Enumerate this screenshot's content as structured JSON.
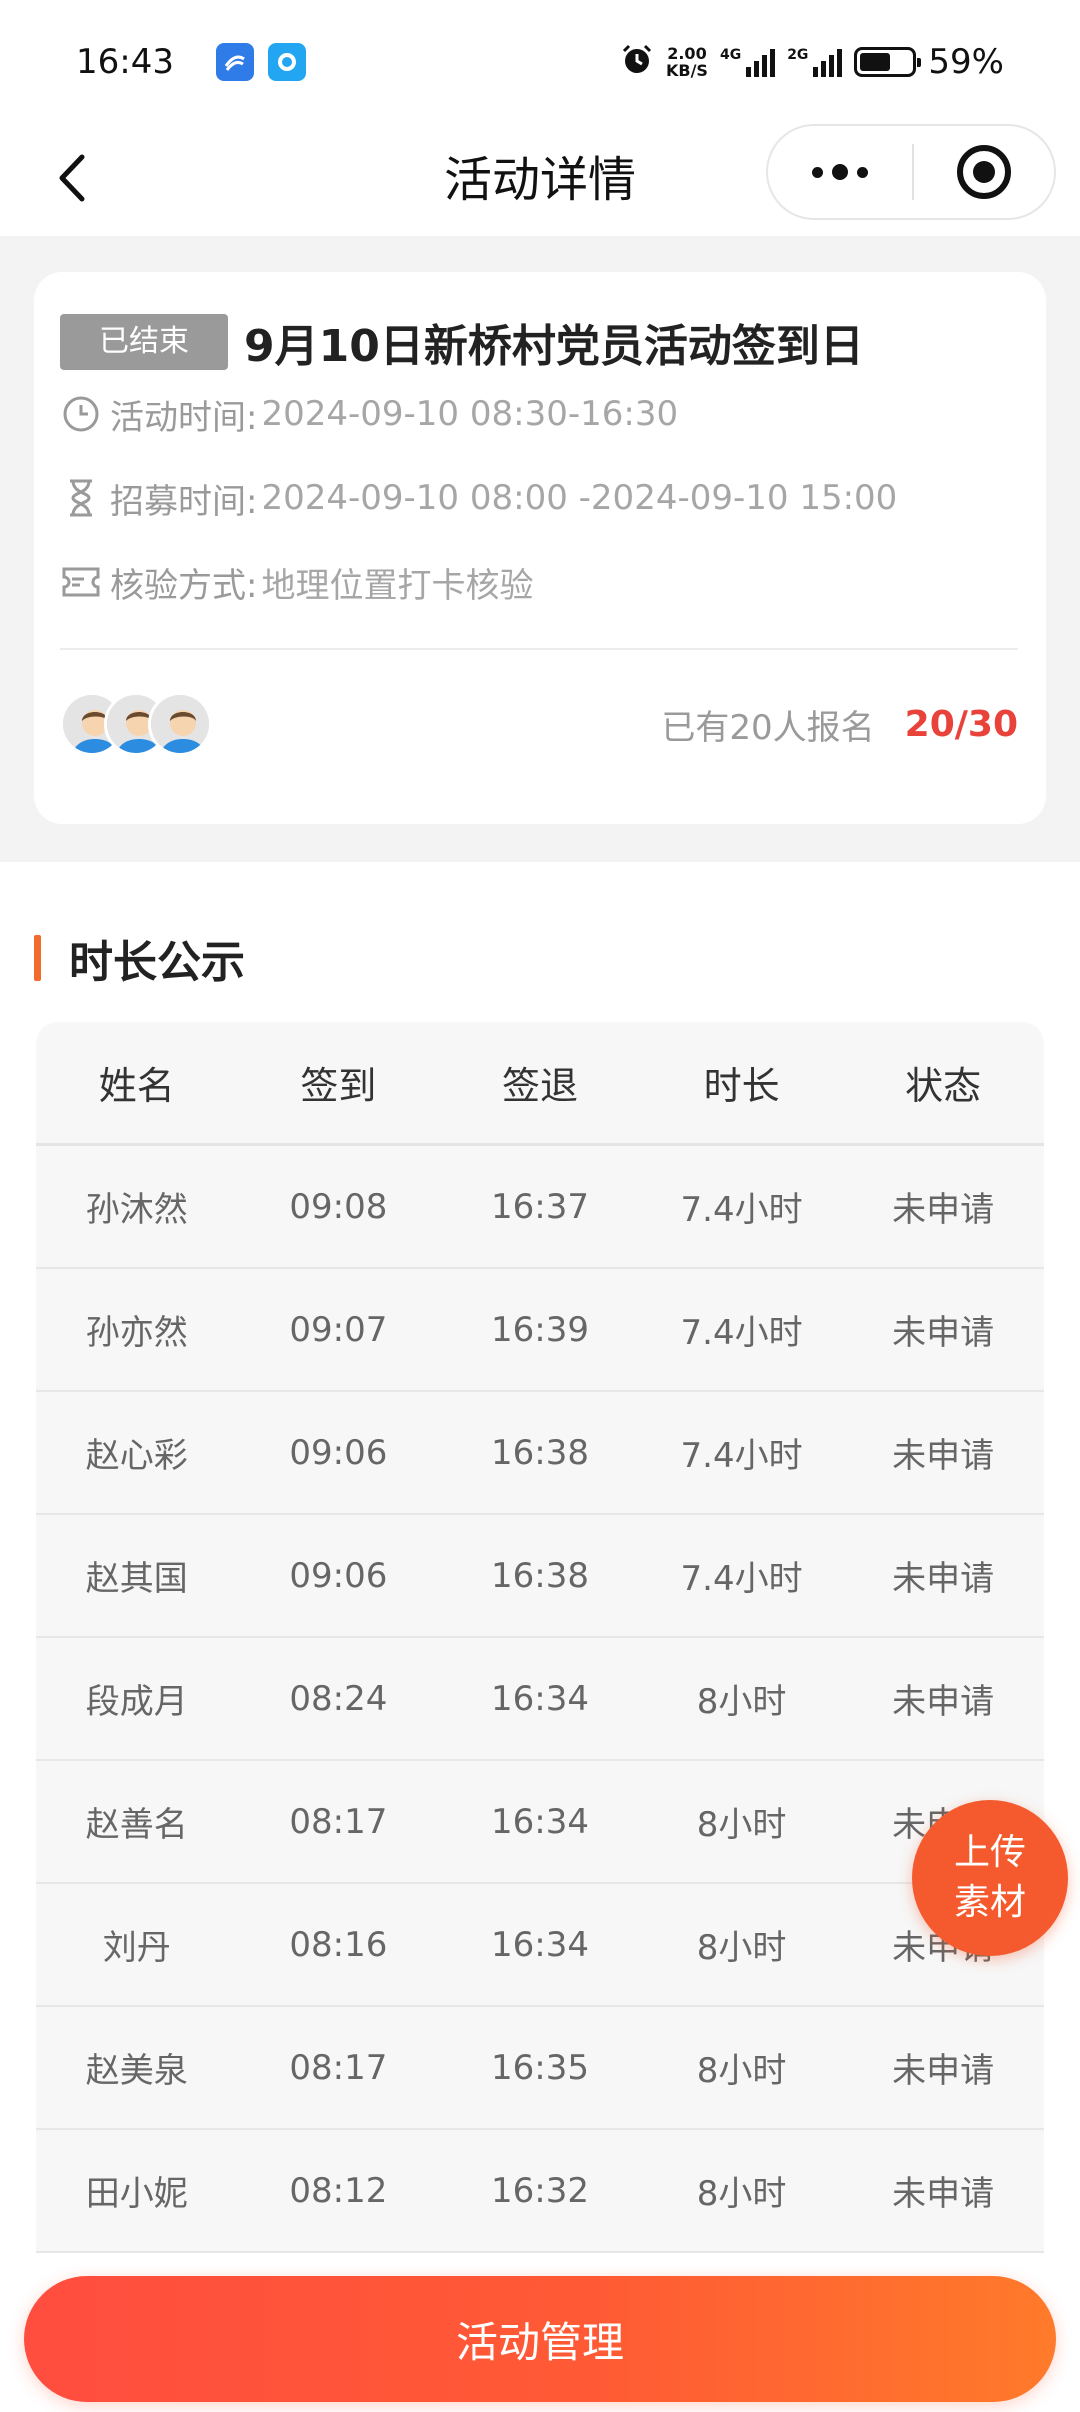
{
  "status_bar": {
    "time": "16:43",
    "net_speed_value": "2.00",
    "net_speed_unit": "KB/S",
    "net1_label": "4G",
    "net2_label": "2G",
    "battery_percent": "59%",
    "battery_level": 0.59
  },
  "nav": {
    "title": "活动详情"
  },
  "activity": {
    "status_tag": "已结束",
    "title": "9月10日新桥村党员活动签到日",
    "time_label": "活动时间:",
    "time_value": "2024-09-10 08:30-16:30",
    "recruit_label": "招募时间:",
    "recruit_value": "2024-09-10 08:00 -2024-09-10 15:00",
    "verify_label": "核验方式:",
    "verify_value": "地理位置打卡核验",
    "signup_text": "已有20人报名",
    "signup_count": "20/30"
  },
  "duration": {
    "section_title": "时长公示",
    "headers": [
      "姓名",
      "签到",
      "签退",
      "时长",
      "状态"
    ],
    "rows": [
      [
        "孙沐然",
        "09:08",
        "16:37",
        "7.4小时",
        "未申请"
      ],
      [
        "孙亦然",
        "09:07",
        "16:39",
        "7.4小时",
        "未申请"
      ],
      [
        "赵心彩",
        "09:06",
        "16:38",
        "7.4小时",
        "未申请"
      ],
      [
        "赵其国",
        "09:06",
        "16:38",
        "7.4小时",
        "未申请"
      ],
      [
        "段成月",
        "08:24",
        "16:34",
        "8小时",
        "未申请"
      ],
      [
        "赵善名",
        "08:17",
        "16:34",
        "8小时",
        "未申请"
      ],
      [
        "刘丹",
        "08:16",
        "16:34",
        "8小时",
        "未申请"
      ],
      [
        "赵美泉",
        "08:17",
        "16:35",
        "8小时",
        "未申请"
      ],
      [
        "田小妮",
        "08:12",
        "16:32",
        "8小时",
        "未申请"
      ]
    ]
  },
  "fab": {
    "line1": "上传",
    "line2": "素材"
  },
  "bottom": {
    "manage_label": "活动管理"
  },
  "colors": {
    "accent": "#f26a2c",
    "count_red": "#e8423a",
    "tag_gray": "#9a9a9a"
  }
}
